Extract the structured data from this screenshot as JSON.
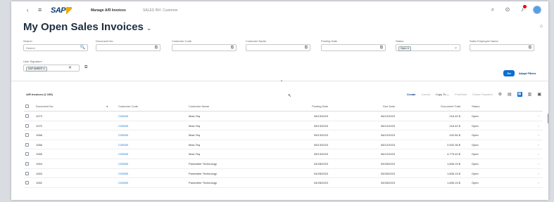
{
  "shell": {
    "back_icon": "back-arrow-icon",
    "menu_icon": "hamburger-icon",
    "logo_text": "SAP",
    "app_title": "Manage A/R Invoices",
    "app_subtitle": "SALES INV. Customer",
    "icons": [
      "search-icon",
      "help-icon",
      "bell-icon",
      "avatar"
    ]
  },
  "page": {
    "title": "My Open Sales Invoices",
    "title_caret": "⌄",
    "collapse_icon": "⌂"
  },
  "filters": [
    {
      "label": "Search",
      "value": "Search",
      "icon": "🔍"
    },
    {
      "label": "Document No.",
      "value": "",
      "icon": "⧉"
    },
    {
      "label": "Customer Code",
      "value": "",
      "icon": "⧉"
    },
    {
      "label": "Customer Name",
      "value": "",
      "icon": "⧉"
    },
    {
      "label": "Posting Date",
      "value": "",
      "icon": "⧉"
    },
    {
      "label": "Status",
      "value": "Open ✕",
      "icon": "⌄"
    },
    {
      "label": "Sales Employee Name",
      "value": "",
      "icon": "⧉"
    }
  ],
  "filter_row2": {
    "label": "User Signature",
    "token": "SAP AMBER ✕",
    "clear": "✕",
    "icon": "⧉"
  },
  "buttons": {
    "go": "Go",
    "adapt_filters": "Adapt Filters"
  },
  "table": {
    "title": "A/R Invoices (2 199)",
    "toolbar": {
      "create": "Create",
      "cancel": "Cancel",
      "copy_to": "Copy To ⌄",
      "print": "Print/Mail",
      "create_payment": "Create Payment"
    },
    "columns": [
      "Document No.",
      "Customer Code",
      "Customer Name",
      "Posting Date",
      "Due Date",
      "Document Total",
      "Status"
    ],
    "rows": [
      {
        "doc": "1073",
        "cust": "C20000",
        "name": "Maxi-Teq",
        "posting": "05/13/2023",
        "due": "06/12/2023",
        "total": "216.42 $",
        "status": "Open"
      },
      {
        "doc": "1070",
        "cust": "C20000",
        "name": "Maxi-Teq",
        "posting": "05/13/2023",
        "due": "06/12/2023",
        "total": "216.42 $",
        "status": "Open"
      },
      {
        "doc": "1068",
        "cust": "C20000",
        "name": "Maxi-Teq",
        "posting": "05/13/2023",
        "due": "06/12/2023",
        "total": "432.84 $",
        "status": "Open"
      },
      {
        "doc": "1066",
        "cust": "C20000",
        "name": "Maxi-Teq",
        "posting": "05/13/2023",
        "due": "06/12/2023",
        "total": "2,532.36 $",
        "status": "Open"
      },
      {
        "doc": "1065",
        "cust": "C20000",
        "name": "Maxi-Teq",
        "posting": "05/13/2023",
        "due": "06/12/2023",
        "total": "4,775.40 $",
        "status": "Open"
      },
      {
        "doc": "1064",
        "cust": "C23900",
        "name": "Parameter Technology",
        "posting": "04/28/2023",
        "due": "05/28/2023",
        "total": "1,806.15 $",
        "status": "Open"
      },
      {
        "doc": "1063",
        "cust": "C23900",
        "name": "Parameter Technology",
        "posting": "04/28/2023",
        "due": "05/28/2023",
        "total": "1,806.15 $",
        "status": "Open"
      },
      {
        "doc": "1062",
        "cust": "C23900",
        "name": "Parameter Technology",
        "posting": "04/28/2023",
        "due": "05/28/2023",
        "total": "1,806.15 $",
        "status": "Open"
      }
    ]
  }
}
